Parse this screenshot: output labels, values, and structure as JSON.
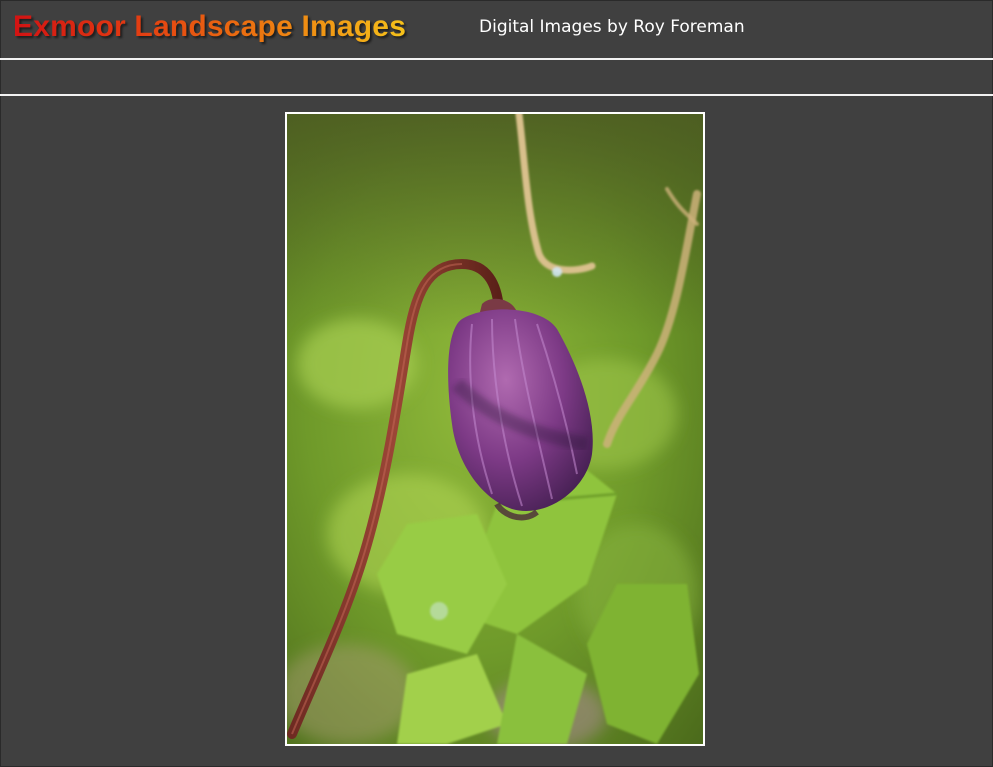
{
  "header": {
    "site_title": "Exmoor Landscape Images",
    "subtitle": "Digital Images by Roy Foreman"
  },
  "colors": {
    "page_background": "#404040",
    "rule": "#f2f2f2",
    "title_gradient": [
      "#d21313",
      "#ec7410",
      "#f6c21a"
    ],
    "subtitle_text": "#ffffff"
  },
  "photo": {
    "subject": "purple flower bud on curved stem",
    "background": "blurred green foliage"
  }
}
